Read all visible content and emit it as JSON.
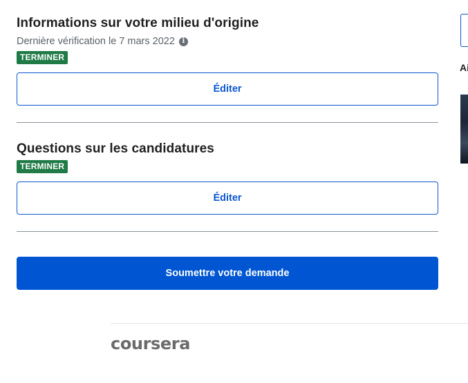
{
  "sections": [
    {
      "title": "Informations sur votre milieu d'origine",
      "verification": "Dernière vérification le 7 mars 2022",
      "status": "TERMINER",
      "edit_label": "Éditer"
    },
    {
      "title": "Questions sur les candidatures",
      "status": "TERMINER",
      "edit_label": "Éditer"
    }
  ],
  "submit_label": "Soumettre votre demande",
  "footer": {
    "logo": "coursera"
  },
  "sidebar": {
    "partial_text": "Ai"
  },
  "colors": {
    "accent": "#0056d2",
    "badge": "#1f7a46"
  }
}
